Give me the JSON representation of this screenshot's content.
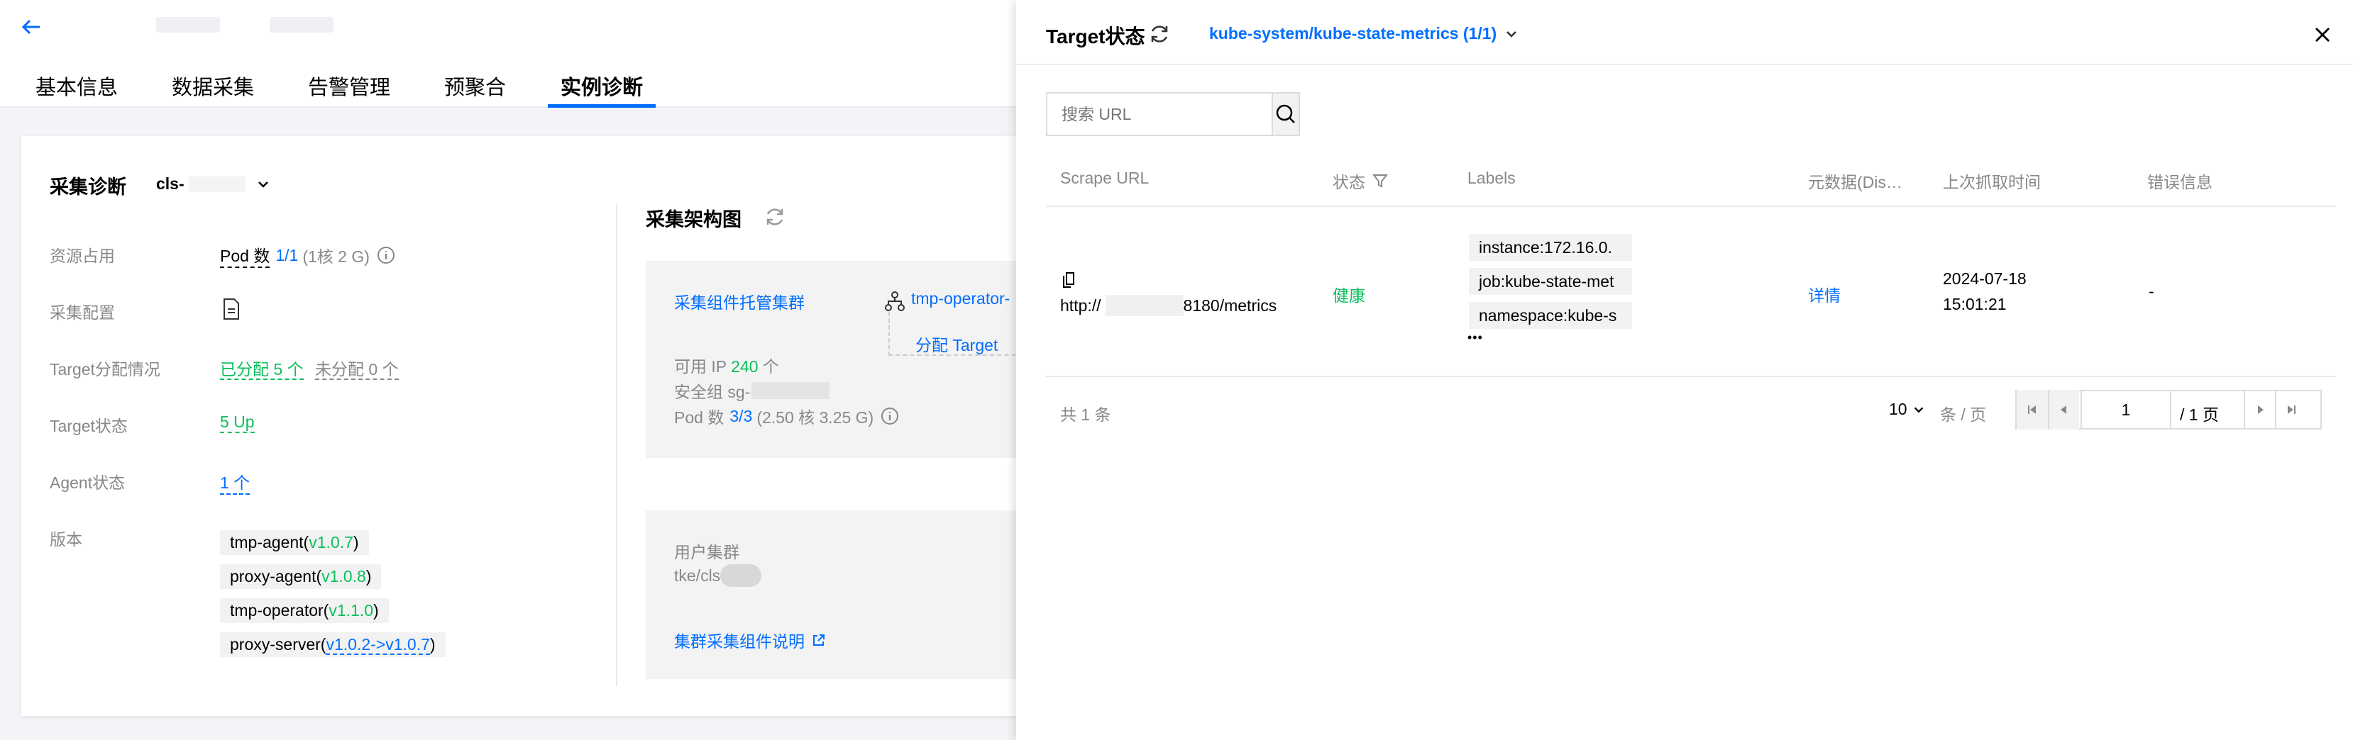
{
  "header": {
    "back_icon": "arrow-left-icon"
  },
  "tabs": [
    {
      "label": "基本信息"
    },
    {
      "label": "数据采集"
    },
    {
      "label": "告警管理"
    },
    {
      "label": "预聚合"
    },
    {
      "label": "实例诊断",
      "active": true
    }
  ],
  "diagnosis": {
    "title": "采集诊断",
    "cluster": "cls-",
    "rows": {
      "resource": {
        "label": "资源占用",
        "pod_prefix": "Pod 数",
        "pod_value": "1/1",
        "pod_detail": "(1核 2 G)"
      },
      "config": {
        "label": "采集配置"
      },
      "target_dist": {
        "label": "Target分配情况",
        "assigned": "已分配 5 个",
        "unassigned": "未分配 0 个"
      },
      "target_status": {
        "label": "Target状态",
        "value": "5 Up"
      },
      "agent_status": {
        "label": "Agent状态",
        "value": "1 个"
      },
      "version": {
        "label": "版本",
        "items": [
          {
            "name": "tmp-agent(",
            "ver": "v1.0.7",
            "end": ")"
          },
          {
            "name": "proxy-agent(",
            "ver": "v1.0.8",
            "end": ")"
          },
          {
            "name": "tmp-operator(",
            "ver": "v1.1.0",
            "end": ")"
          },
          {
            "name": "proxy-server(",
            "ver": "v1.0.2->v1.0.7",
            "end": ")"
          }
        ]
      }
    }
  },
  "architecture": {
    "title": "采集架构图",
    "managed_cluster_link": "采集组件托管集群",
    "operator_link": "tmp-operator-",
    "assign_target": "分配 Target",
    "ip_prefix": "可用 IP",
    "ip_value": "240",
    "ip_suffix": "个",
    "sg_label": "安全组 sg-",
    "pod_prefix": "Pod 数",
    "pod_value": "3/3",
    "pod_detail": "(2.50 核 3.25 G)",
    "user_cluster_label": "用户集群",
    "user_cluster_value": "tke/cls",
    "doc_link": "集群采集组件说明"
  },
  "drawer": {
    "title": "Target状态",
    "selector": "kube-system/kube-state-metrics (1/1)",
    "search_placeholder": "搜索 URL",
    "columns": [
      "Scrape URL",
      "状态",
      "Labels",
      "元数据(Dis…",
      "上次抓取时间",
      "错误信息"
    ],
    "row": {
      "url_prefix": "http://",
      "url_suffix": "8180/metrics",
      "status": "健康",
      "labels": [
        "instance:172.16.0.",
        "job:kube-state-met",
        "namespace:kube-s"
      ],
      "more": "• • •",
      "metadata": "详情",
      "last_scrape_date": "2024-07-18",
      "last_scrape_time": "15:01:21",
      "error": "-"
    },
    "pagination": {
      "total": "共 1 条",
      "page_size": "10",
      "per_page": "条 / 页",
      "current_page": "1",
      "total_pages": "/ 1 页"
    }
  }
}
